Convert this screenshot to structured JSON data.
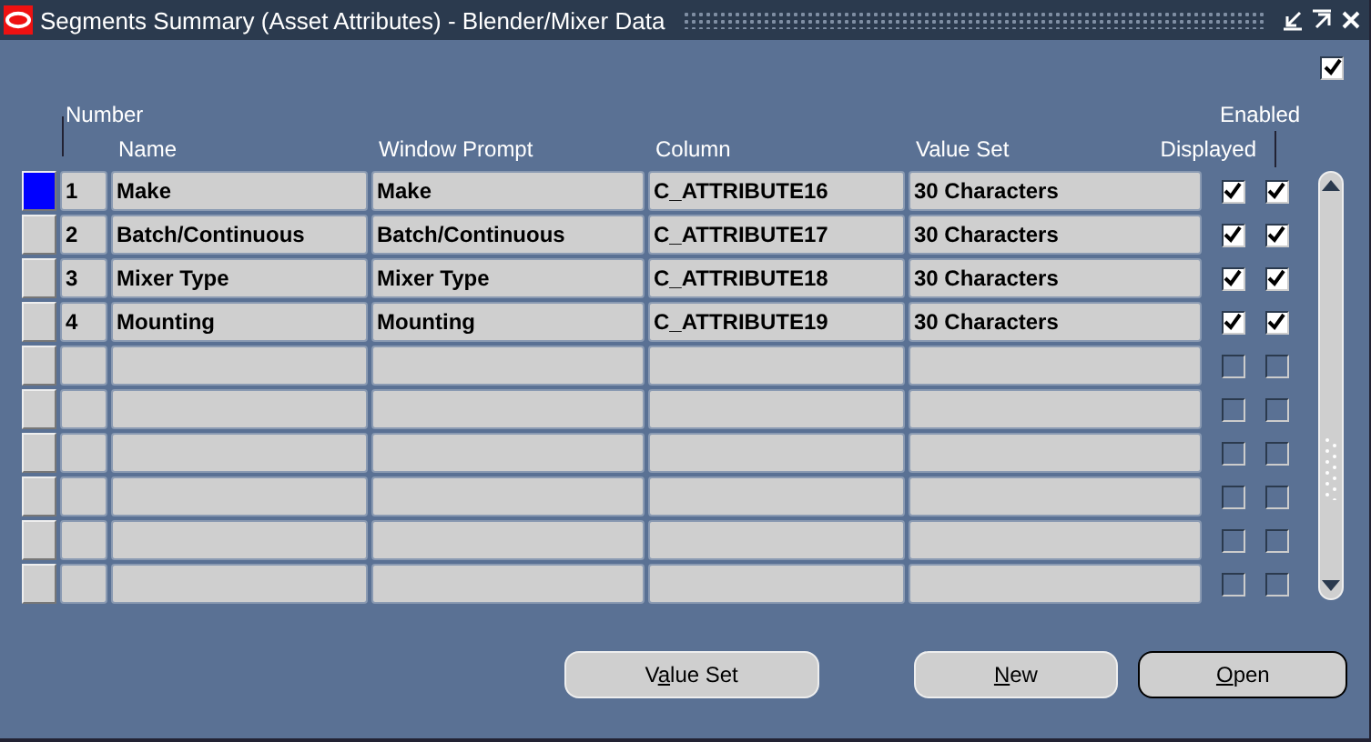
{
  "window": {
    "title": "Segments Summary (Asset Attributes) - Blender/Mixer Data"
  },
  "top_checkbox": {
    "checked": true
  },
  "columns": {
    "number": "Number",
    "name": "Name",
    "window_prompt": "Window Prompt",
    "column": "Column",
    "value_set": "Value Set",
    "displayed": "Displayed",
    "enabled": "Enabled"
  },
  "rows": [
    {
      "number": "1",
      "name": "Make",
      "window_prompt": "Make",
      "column": "C_ATTRIBUTE16",
      "value_set": "30 Characters",
      "displayed": true,
      "enabled": true,
      "selected": true
    },
    {
      "number": "2",
      "name": "Batch/Continuous",
      "window_prompt": "Batch/Continuous",
      "column": "C_ATTRIBUTE17",
      "value_set": "30 Characters",
      "displayed": true,
      "enabled": true,
      "selected": false
    },
    {
      "number": "3",
      "name": "Mixer Type",
      "window_prompt": "Mixer Type",
      "column": "C_ATTRIBUTE18",
      "value_set": "30 Characters",
      "displayed": true,
      "enabled": true,
      "selected": false
    },
    {
      "number": "4",
      "name": "Mounting",
      "window_prompt": "Mounting",
      "column": "C_ATTRIBUTE19",
      "value_set": "30 Characters",
      "displayed": true,
      "enabled": true,
      "selected": false
    },
    {
      "displayed": false,
      "enabled": false,
      "selected": false
    },
    {
      "displayed": false,
      "enabled": false,
      "selected": false
    },
    {
      "displayed": false,
      "enabled": false,
      "selected": false
    },
    {
      "displayed": false,
      "enabled": false,
      "selected": false
    },
    {
      "displayed": false,
      "enabled": false,
      "selected": false
    },
    {
      "displayed": false,
      "enabled": false,
      "selected": false
    }
  ],
  "buttons": [
    {
      "label": [
        {
          "text": "V",
          "underlined": false
        },
        {
          "text": "a",
          "underlined": true
        },
        {
          "text": "lue Set",
          "underlined": false
        }
      ],
      "default": false
    },
    {
      "label": [
        {
          "text": "N",
          "underlined": true
        },
        {
          "text": "ew",
          "underlined": false
        }
      ],
      "default": false
    },
    {
      "label": [
        {
          "text": "O",
          "underlined": true
        },
        {
          "text": "pen",
          "underlined": false
        }
      ],
      "default": true
    }
  ]
}
